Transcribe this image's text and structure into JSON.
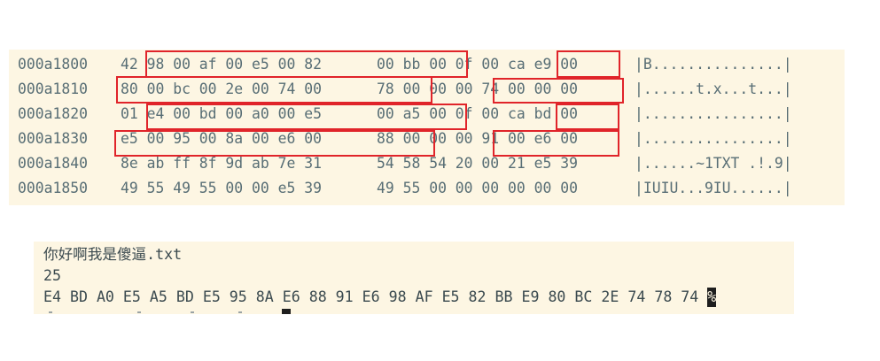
{
  "hex_dump": {
    "rows": [
      {
        "offset": "000a1800",
        "bytes1": "42 98 00 af 00 e5 00 82",
        "bytes2": "00 bb 00 0f 00 ca e9 00",
        "ascii": "|B...............|"
      },
      {
        "offset": "000a1810",
        "bytes1": "80 00 bc 00 2e 00 74 00",
        "bytes2": "78 00 00 00 74 00 00 00",
        "ascii": "|......t.x...t...|"
      },
      {
        "offset": "000a1820",
        "bytes1": "01 e4 00 bd 00 a0 00 e5",
        "bytes2": "00 a5 00 0f 00 ca bd 00",
        "ascii": "|................|"
      },
      {
        "offset": "000a1830",
        "bytes1": "e5 00 95 00 8a 00 e6 00",
        "bytes2": "88 00 00 00 91 00 e6 00",
        "ascii": "|................|"
      },
      {
        "offset": "000a1840",
        "bytes1": "8e ab ff 8f 9d ab 7e 31",
        "bytes2": "54 58 54 20 00 21 e5 39",
        "ascii": "|......~1TXT .!.9|"
      },
      {
        "offset": "000a1850",
        "bytes1": "49 55 49 55 00 00 e5 39",
        "bytes2": "49 55 00 00 00 00 00 00",
        "ascii": "|IUIU...9IU......|"
      }
    ],
    "highlight_color": "#e0242a"
  },
  "terminal": {
    "filename_prefix": "你好啊我是傻逼",
    "filename_ext": ".txt",
    "length": "25",
    "hex_output": "E4 BD A0 E5 A5 BD E5 95 8A E6 88 91 E6 98 AF E5 82 BB E9 80 BC 2E 74 78 74 ",
    "prompt_symbol": "%"
  }
}
